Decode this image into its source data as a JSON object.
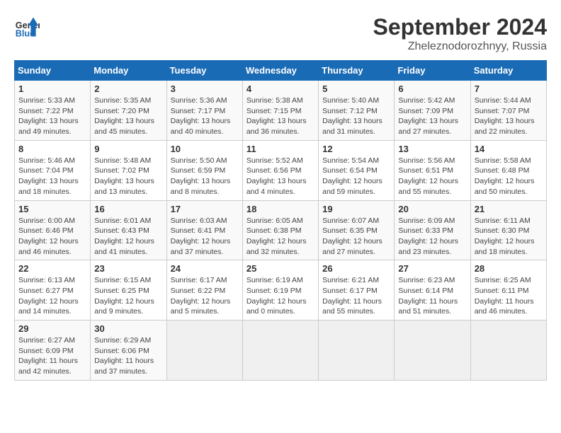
{
  "header": {
    "logo_general": "General",
    "logo_blue": "Blue",
    "month_title": "September 2024",
    "subtitle": "Zheleznodorozhnyy, Russia"
  },
  "days_of_week": [
    "Sunday",
    "Monday",
    "Tuesday",
    "Wednesday",
    "Thursday",
    "Friday",
    "Saturday"
  ],
  "weeks": [
    [
      {
        "day": "1",
        "info": "Sunrise: 5:33 AM\nSunset: 7:22 PM\nDaylight: 13 hours\nand 49 minutes."
      },
      {
        "day": "2",
        "info": "Sunrise: 5:35 AM\nSunset: 7:20 PM\nDaylight: 13 hours\nand 45 minutes."
      },
      {
        "day": "3",
        "info": "Sunrise: 5:36 AM\nSunset: 7:17 PM\nDaylight: 13 hours\nand 40 minutes."
      },
      {
        "day": "4",
        "info": "Sunrise: 5:38 AM\nSunset: 7:15 PM\nDaylight: 13 hours\nand 36 minutes."
      },
      {
        "day": "5",
        "info": "Sunrise: 5:40 AM\nSunset: 7:12 PM\nDaylight: 13 hours\nand 31 minutes."
      },
      {
        "day": "6",
        "info": "Sunrise: 5:42 AM\nSunset: 7:09 PM\nDaylight: 13 hours\nand 27 minutes."
      },
      {
        "day": "7",
        "info": "Sunrise: 5:44 AM\nSunset: 7:07 PM\nDaylight: 13 hours\nand 22 minutes."
      }
    ],
    [
      {
        "day": "8",
        "info": "Sunrise: 5:46 AM\nSunset: 7:04 PM\nDaylight: 13 hours\nand 18 minutes."
      },
      {
        "day": "9",
        "info": "Sunrise: 5:48 AM\nSunset: 7:02 PM\nDaylight: 13 hours\nand 13 minutes."
      },
      {
        "day": "10",
        "info": "Sunrise: 5:50 AM\nSunset: 6:59 PM\nDaylight: 13 hours\nand 8 minutes."
      },
      {
        "day": "11",
        "info": "Sunrise: 5:52 AM\nSunset: 6:56 PM\nDaylight: 13 hours\nand 4 minutes."
      },
      {
        "day": "12",
        "info": "Sunrise: 5:54 AM\nSunset: 6:54 PM\nDaylight: 12 hours\nand 59 minutes."
      },
      {
        "day": "13",
        "info": "Sunrise: 5:56 AM\nSunset: 6:51 PM\nDaylight: 12 hours\nand 55 minutes."
      },
      {
        "day": "14",
        "info": "Sunrise: 5:58 AM\nSunset: 6:48 PM\nDaylight: 12 hours\nand 50 minutes."
      }
    ],
    [
      {
        "day": "15",
        "info": "Sunrise: 6:00 AM\nSunset: 6:46 PM\nDaylight: 12 hours\nand 46 minutes."
      },
      {
        "day": "16",
        "info": "Sunrise: 6:01 AM\nSunset: 6:43 PM\nDaylight: 12 hours\nand 41 minutes."
      },
      {
        "day": "17",
        "info": "Sunrise: 6:03 AM\nSunset: 6:41 PM\nDaylight: 12 hours\nand 37 minutes."
      },
      {
        "day": "18",
        "info": "Sunrise: 6:05 AM\nSunset: 6:38 PM\nDaylight: 12 hours\nand 32 minutes."
      },
      {
        "day": "19",
        "info": "Sunrise: 6:07 AM\nSunset: 6:35 PM\nDaylight: 12 hours\nand 27 minutes."
      },
      {
        "day": "20",
        "info": "Sunrise: 6:09 AM\nSunset: 6:33 PM\nDaylight: 12 hours\nand 23 minutes."
      },
      {
        "day": "21",
        "info": "Sunrise: 6:11 AM\nSunset: 6:30 PM\nDaylight: 12 hours\nand 18 minutes."
      }
    ],
    [
      {
        "day": "22",
        "info": "Sunrise: 6:13 AM\nSunset: 6:27 PM\nDaylight: 12 hours\nand 14 minutes."
      },
      {
        "day": "23",
        "info": "Sunrise: 6:15 AM\nSunset: 6:25 PM\nDaylight: 12 hours\nand 9 minutes."
      },
      {
        "day": "24",
        "info": "Sunrise: 6:17 AM\nSunset: 6:22 PM\nDaylight: 12 hours\nand 5 minutes."
      },
      {
        "day": "25",
        "info": "Sunrise: 6:19 AM\nSunset: 6:19 PM\nDaylight: 12 hours\nand 0 minutes."
      },
      {
        "day": "26",
        "info": "Sunrise: 6:21 AM\nSunset: 6:17 PM\nDaylight: 11 hours\nand 55 minutes."
      },
      {
        "day": "27",
        "info": "Sunrise: 6:23 AM\nSunset: 6:14 PM\nDaylight: 11 hours\nand 51 minutes."
      },
      {
        "day": "28",
        "info": "Sunrise: 6:25 AM\nSunset: 6:11 PM\nDaylight: 11 hours\nand 46 minutes."
      }
    ],
    [
      {
        "day": "29",
        "info": "Sunrise: 6:27 AM\nSunset: 6:09 PM\nDaylight: 11 hours\nand 42 minutes."
      },
      {
        "day": "30",
        "info": "Sunrise: 6:29 AM\nSunset: 6:06 PM\nDaylight: 11 hours\nand 37 minutes."
      },
      {
        "day": "",
        "info": ""
      },
      {
        "day": "",
        "info": ""
      },
      {
        "day": "",
        "info": ""
      },
      {
        "day": "",
        "info": ""
      },
      {
        "day": "",
        "info": ""
      }
    ]
  ]
}
